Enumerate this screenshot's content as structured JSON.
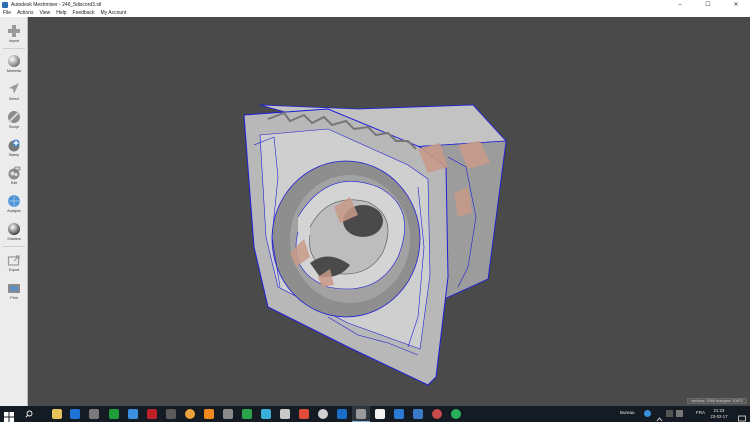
{
  "window": {
    "title": "Autodesk Meshmixer - 246_5discord3.stl",
    "controls": [
      "–",
      "☐",
      "✕"
    ]
  },
  "menu": [
    "File",
    "Actions",
    "View",
    "Help",
    "Feedback",
    "My Account"
  ],
  "toolbar": {
    "tools": [
      {
        "label": "Import",
        "icon": "plus-icon"
      },
      {
        "label": "Meshmix",
        "icon": "sphere-icon"
      },
      {
        "label": "Select",
        "icon": "cursor-arrow-icon"
      },
      {
        "label": "Sculpt",
        "icon": "brush-icon"
      },
      {
        "label": "Stamp",
        "icon": "stamp-icon"
      },
      {
        "label": "Edit",
        "icon": "edit-icon"
      },
      {
        "label": "Analysis",
        "icon": "analysis-icon"
      },
      {
        "label": "Shaders",
        "icon": "shader-icon"
      },
      {
        "label": "Export",
        "icon": "export-icon"
      },
      {
        "label": "Print",
        "icon": "print-icon"
      }
    ]
  },
  "viewport": {
    "background": "#4a4a4a",
    "status": "vertices: 5366 triangles: 10672"
  },
  "taskbar": {
    "tray": {
      "label": "Bureau",
      "lang": "FRA",
      "time": "21:23",
      "date": "23-02-17"
    }
  },
  "colors": {
    "wireframe": "#1f1fd6",
    "mesh": "#bdbdbd",
    "highlight": "#c89a8a"
  }
}
